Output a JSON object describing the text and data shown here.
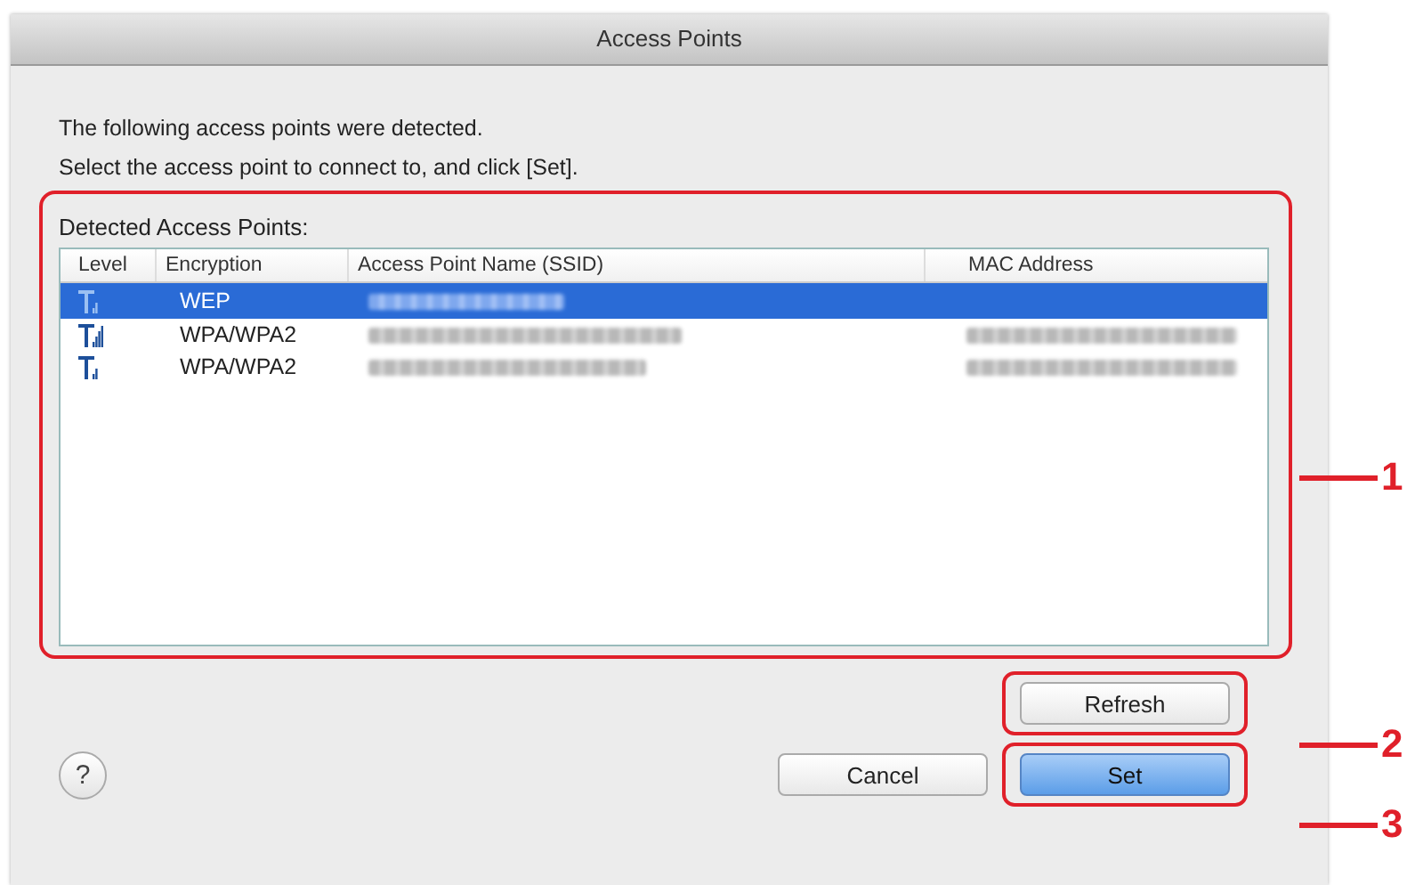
{
  "window": {
    "title": "Access Points"
  },
  "intro": [
    "The following access points were detected.",
    "Select the access point to connect to, and click [Set]."
  ],
  "list_label": "Detected Access Points:",
  "table": {
    "columns": [
      "Level",
      "Encryption",
      "Access Point Name (SSID)",
      "MAC Address"
    ],
    "rows": [
      {
        "selected": true,
        "kind": "weak",
        "encryption": "WEP",
        "ssid_blurred": true,
        "mac_blurred": false
      },
      {
        "selected": false,
        "kind": "strong",
        "encryption": "WPA/WPA2",
        "ssid_blurred": true,
        "mac_blurred": true
      },
      {
        "selected": false,
        "kind": "weak",
        "encryption": "WPA/WPA2",
        "ssid_blurred": true,
        "mac_blurred": true
      }
    ]
  },
  "buttons": {
    "refresh": "Refresh",
    "cancel": "Cancel",
    "set": "Set",
    "help": "?"
  },
  "callouts": [
    "1",
    "2",
    "3"
  ]
}
